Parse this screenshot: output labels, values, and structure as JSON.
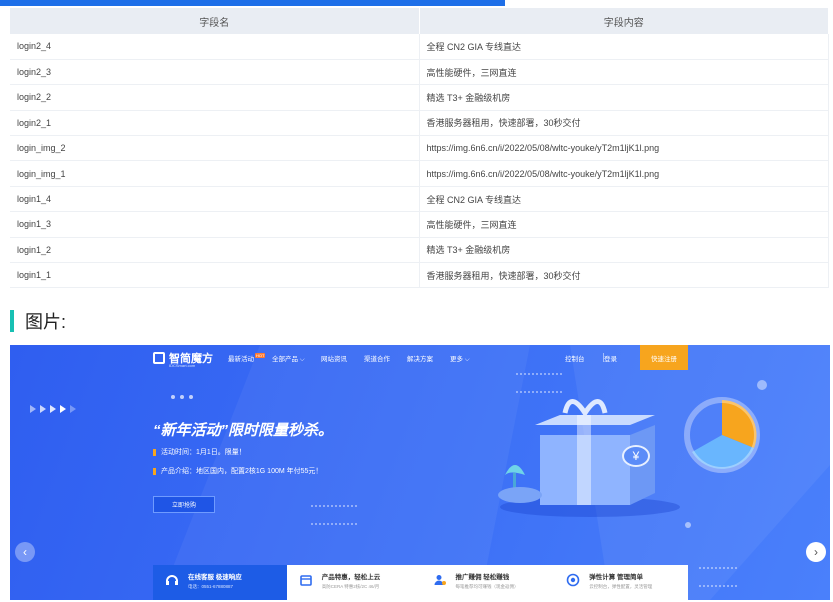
{
  "table": {
    "headers": [
      "字段名",
      "字段内容"
    ],
    "rows": [
      [
        "login2_4",
        "全程 CN2 GIA 专线直达"
      ],
      [
        "login2_3",
        "高性能硬件，三网直连"
      ],
      [
        "login2_2",
        "精选 T3+ 金融级机房"
      ],
      [
        "login2_1",
        "香港服务器租用，快速部署，30秒交付"
      ],
      [
        "login_img_2",
        "https://img.6n6.cn/i/2022/05/08/wltc-youke/yT2m1ljK1l.png"
      ],
      [
        "login_img_1",
        "https://img.6n6.cn/i/2022/05/08/wltc-youke/yT2m1ljK1l.png"
      ],
      [
        "login1_4",
        "全程 CN2 GIA 专线直达"
      ],
      [
        "login1_3",
        "高性能硬件，三网直连"
      ],
      [
        "login1_2",
        "精选 T3+ 金融级机房"
      ],
      [
        "login1_1",
        "香港服务器租用，快速部署，30秒交付"
      ]
    ]
  },
  "section": {
    "title": "图片:"
  },
  "banner": {
    "logo": "智简魔方",
    "logo_sub": "IDCSmart.com",
    "nav": {
      "activity": "最新活动",
      "hot": "HOT",
      "products": "全部产品 ⌵",
      "news": "网站资讯",
      "partner": "渠道合作",
      "solution": "解决方案",
      "more": "更多 ⌵",
      "console": "控制台",
      "login": "登录",
      "register": "快速注册"
    },
    "headline": "“新年活动”限时限量秒杀。",
    "time_text": "活动时间：1月1日。限量！",
    "product_text": "产品介绍：地区国内，配置2核1G 100M 年付55元！",
    "buy_button": "立即抢购",
    "coin_symbol": "¥",
    "features": [
      {
        "icon": "headset-icon",
        "title": "在线客服 极速响应",
        "desc": "电话：0551-67880887"
      },
      {
        "icon": "cart-icon",
        "title": "产品特惠，轻松上云",
        "desc": "高防CERA 特惠2核/2C 46/月"
      },
      {
        "icon": "user-share-icon",
        "title": "推广赚佣 轻松赚钱",
        "desc": "每笔推荐均可赚钱（现金返佣）"
      },
      {
        "icon": "compute-icon",
        "title": "弹性计算 管理简单",
        "desc": "云控制台，弹性配置，灵活管理"
      }
    ]
  },
  "colors": {
    "banner_blue": "#3a6df5",
    "accent_orange": "#f7a51e",
    "section_teal": "#17c0b3"
  }
}
